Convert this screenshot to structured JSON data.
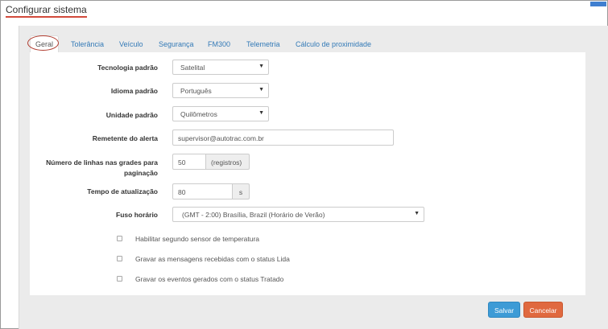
{
  "page": {
    "title": "Configurar sistema"
  },
  "tabs": [
    {
      "label": "Geral",
      "active": true
    },
    {
      "label": "Tolerância"
    },
    {
      "label": "Veículo"
    },
    {
      "label": "Segurança"
    },
    {
      "label": "FM300"
    },
    {
      "label": "Telemetria"
    },
    {
      "label": "Cálculo de proximidade"
    }
  ],
  "form": {
    "technology": {
      "label": "Tecnologia padrão",
      "value": "Satelital"
    },
    "language": {
      "label": "Idioma padrão",
      "value": "Português"
    },
    "unit": {
      "label": "Unidade padrão",
      "value": "Quilômetros"
    },
    "sender": {
      "label": "Remetente do alerta",
      "value": "supervisor@autotrac.com.br"
    },
    "grid_lines": {
      "label_line1": "Número de linhas nas grades para",
      "label_line2": "paginação",
      "value": "50",
      "addon": "(registros)"
    },
    "refresh": {
      "label": "Tempo de atualização",
      "value": "80",
      "addon": "s"
    },
    "timezone": {
      "label": "Fuso horário",
      "value": "(GMT - 2:00) Brasília, Brazil (Horário de Verão)"
    }
  },
  "checkboxes": [
    {
      "label": "Habilitar segundo sensor de temperatura",
      "checked": false
    },
    {
      "label": "Gravar as mensagens recebidas com o status Lida",
      "checked": false
    },
    {
      "label": "Gravar os eventos gerados com o status Tratado",
      "checked": false
    }
  ],
  "actions": {
    "save_label": "Salvar",
    "cancel_label": "Cancelar"
  },
  "icons": {
    "caret": "caret-down-icon"
  },
  "colors": {
    "accent_underline": "#d24a3c",
    "save": "#3d9bd6",
    "cancel": "#e0693f",
    "link": "#337ab7"
  }
}
